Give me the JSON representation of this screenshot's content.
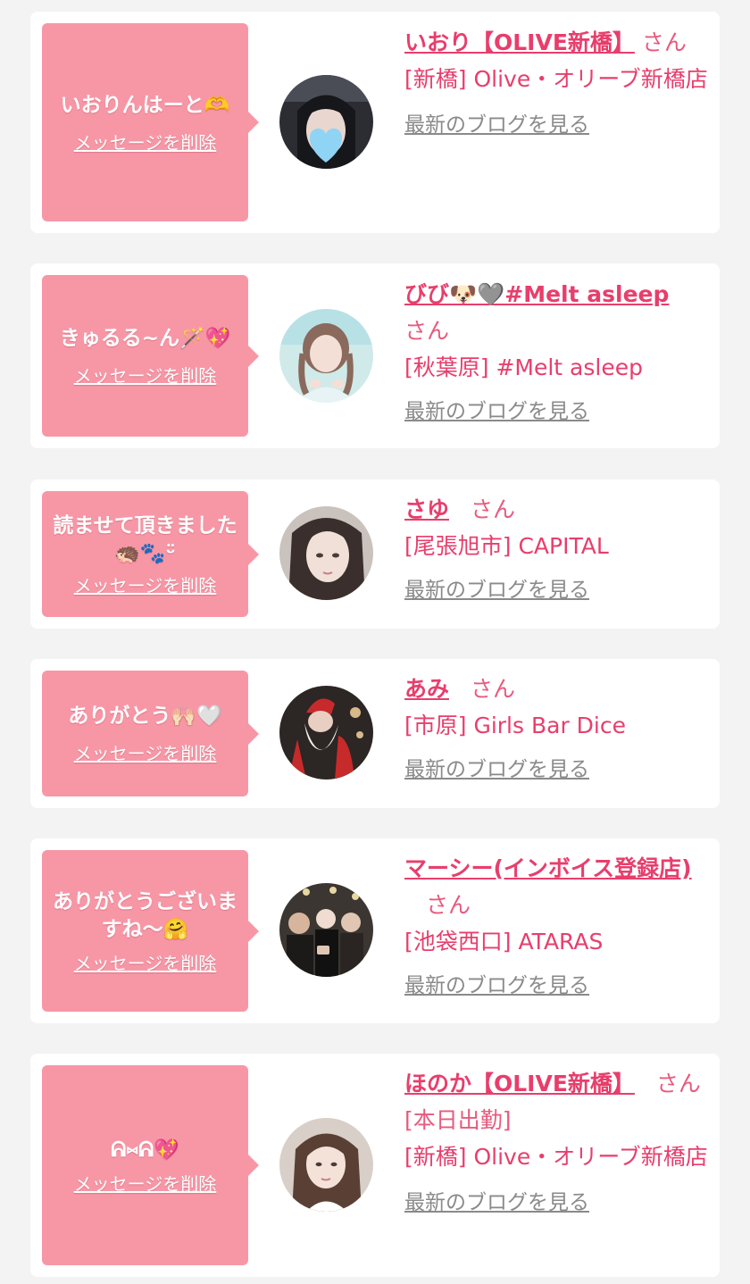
{
  "items": [
    {
      "message": "いおりんはーと🫶",
      "delete_label": "メッセージを削除",
      "name": "いおり【OLIVE新橋】",
      "suffix": "さん",
      "shop": "[新橋] Olive・オリーブ新橋店",
      "blog_label": "最新のブログを見る",
      "avatar_icon": "girl-with-blue-heart-avatar"
    },
    {
      "message": "きゅるる~ん🪄💖",
      "delete_label": "メッセージを削除",
      "name": "びび🐶🩶#Melt asleep",
      "suffix": "さん",
      "shop": "[秋葉原] #Melt asleep",
      "blog_label": "最新のブログを見る",
      "avatar_icon": "girl-with-braids-avatar"
    },
    {
      "message": "読ませて頂きました🦔🐾ᵕ̈",
      "delete_label": "メッセージを削除",
      "name": "さゆ",
      "suffix": "さん",
      "shop": "[尾張旭市] CAPITAL",
      "blog_label": "最新のブログを見る",
      "avatar_icon": "girl-portrait-avatar"
    },
    {
      "message": "ありがとう🙌🏻🤍",
      "delete_label": "メッセージを削除",
      "name": "あみ",
      "suffix": "さん",
      "shop": "[市原] Girls Bar Dice",
      "blog_label": "最新のブログを見る",
      "avatar_icon": "santa-costume-avatar"
    },
    {
      "message": "ありがとうございますね～🤗",
      "delete_label": "メッセージを削除",
      "name": "マーシー(インボイス登録店)",
      "suffix": "さん",
      "shop": "[池袋西口] ATARAS",
      "blog_label": "最新のブログを見る",
      "avatar_icon": "group-photo-avatar"
    },
    {
      "message": "ᕱ⑅ᕱ💖",
      "delete_label": "メッセージを削除",
      "name": "ほのか【OLIVE新橋】",
      "suffix": "さん[本日出勤]",
      "shop": "[新橋] Olive・オリーブ新橋店",
      "blog_label": "最新のブログを見る",
      "avatar_icon": "girl-long-hair-avatar"
    }
  ],
  "colors": {
    "background": "#f3f3f3",
    "card": "#ffffff",
    "bubble": "#f797a6",
    "name": "#e83e6c",
    "blog_link": "#8a8a8a"
  }
}
